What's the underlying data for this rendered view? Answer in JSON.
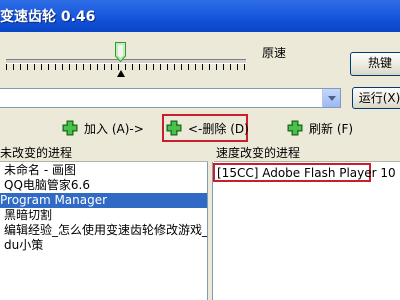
{
  "window": {
    "title": "变速齿轮 0.46"
  },
  "slider": {
    "label": "原速"
  },
  "toolbar": {
    "hotkey_label": "热键",
    "run_label": "运行(X)"
  },
  "process_combo": {
    "value": ""
  },
  "actions": {
    "add_label": "加入 (A)->",
    "delete_label": "<-删除 (D)",
    "refresh_label": "刷新 (F)"
  },
  "left_panel": {
    "header": "未改变的进程",
    "items": [
      "未命名 - 画图",
      "QQ电脑管家6.6",
      "Program Manager",
      "黑暗切割",
      "编辑经验_怎么使用变速齿轮修改游戏_百度",
      "du小策"
    ]
  },
  "right_panel": {
    "header": "速度改变的进程",
    "items": [
      "[15CC]  Adobe Flash Player 10"
    ]
  },
  "colors": {
    "accent": "#316ac5",
    "highlight_border": "#c8202a",
    "titlebar": "#1f5fe0"
  },
  "icons": [
    "green-plus-icon",
    "green-plus-icon",
    "green-plus-icon"
  ]
}
